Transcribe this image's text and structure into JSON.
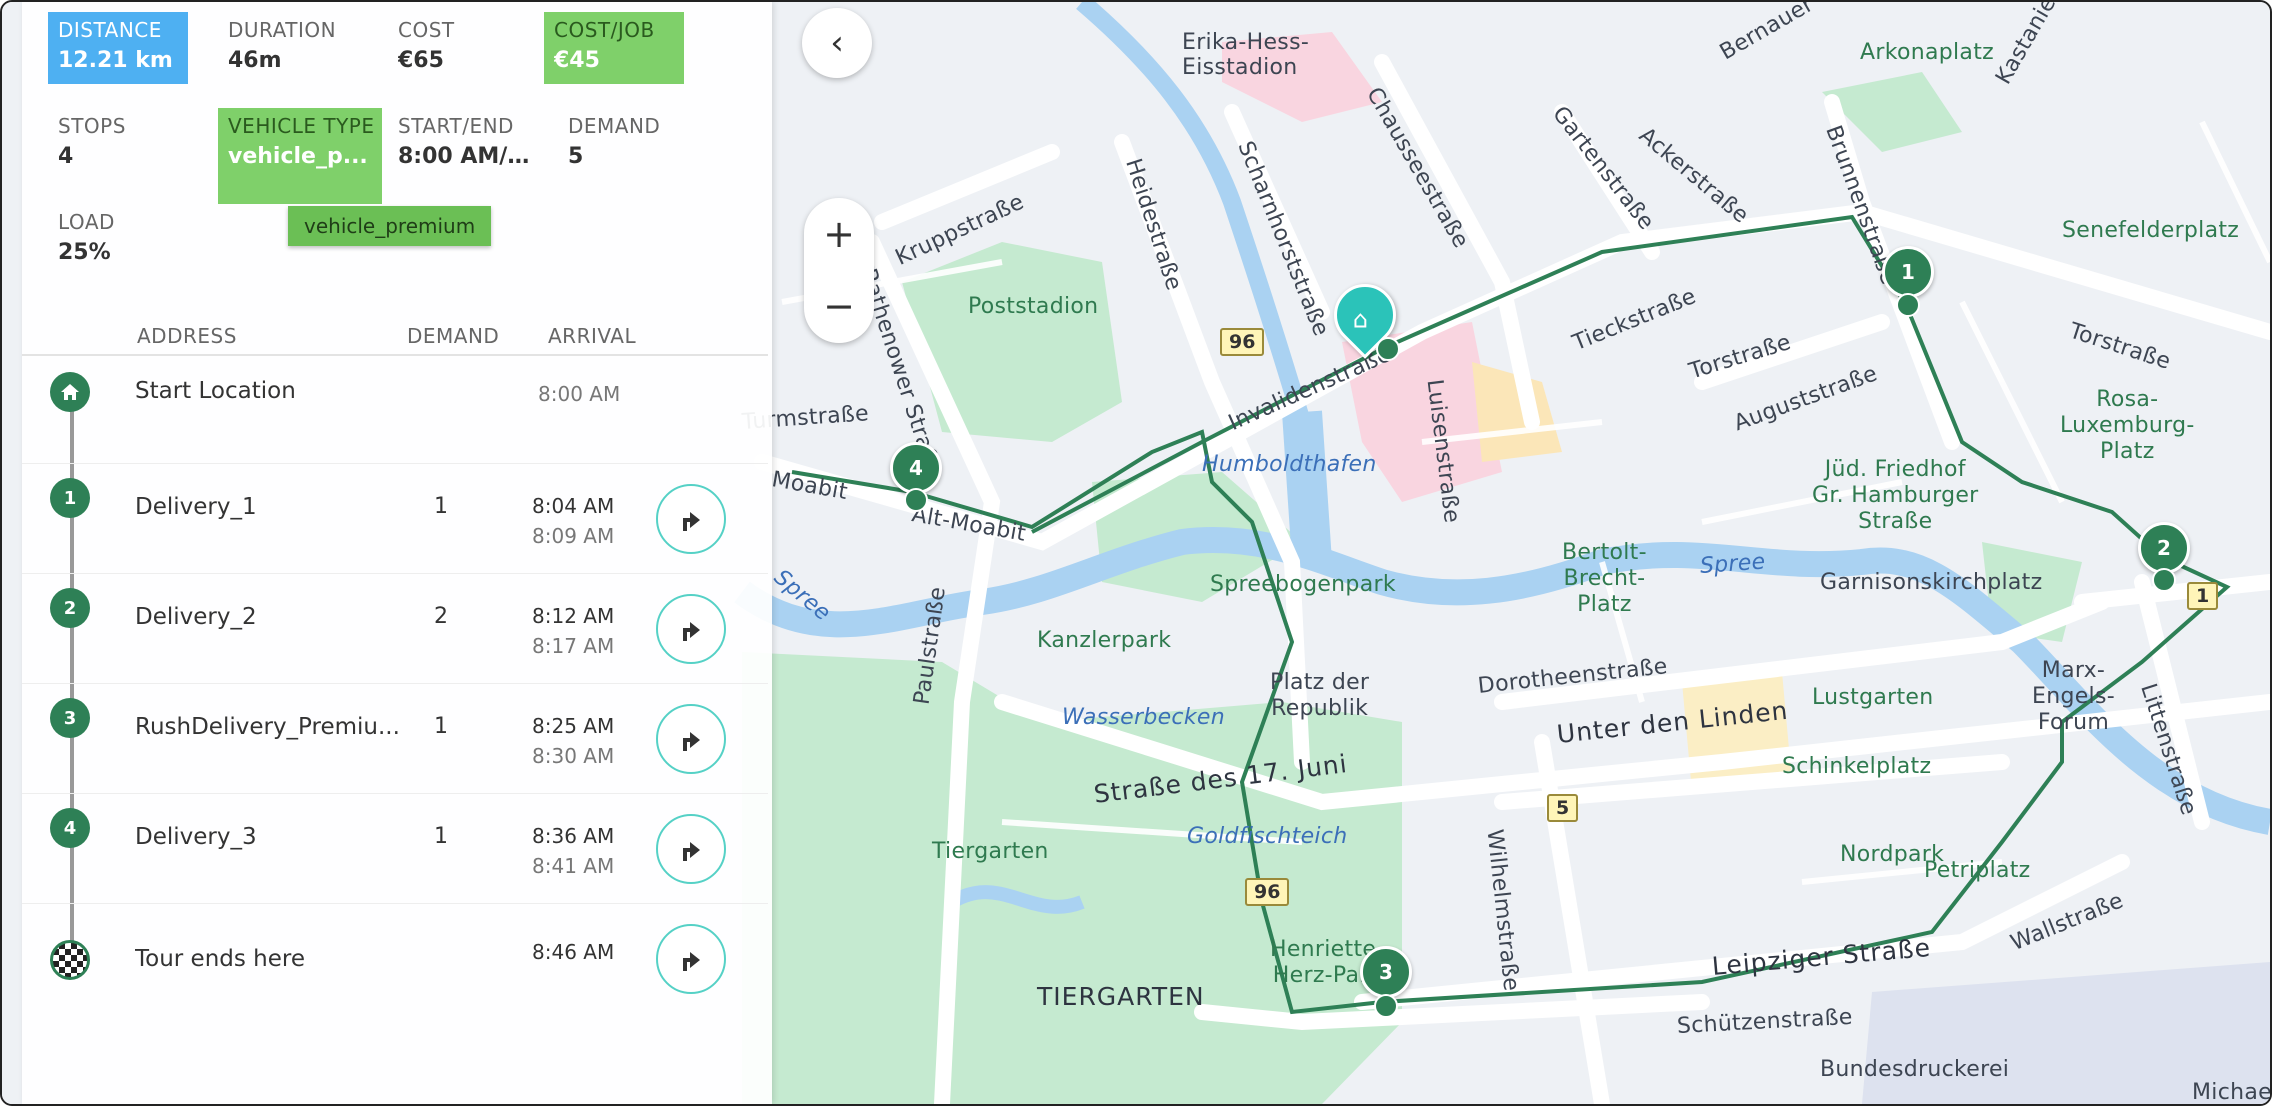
{
  "stats": {
    "distance": {
      "label": "DISTANCE",
      "value": "12.21 km"
    },
    "duration": {
      "label": "DURATION",
      "value": "46m"
    },
    "cost": {
      "label": "COST",
      "value": "€65"
    },
    "cost_job": {
      "label": "COST/JOB",
      "value": "€45"
    },
    "stops": {
      "label": "STOPS",
      "value": "4"
    },
    "vehicle_type": {
      "label": "VEHICLE TYPE",
      "value": "vehicle_p..."
    },
    "start_end": {
      "label": "START/END",
      "value": "8:00 AM/8:..."
    },
    "demand": {
      "label": "DEMAND",
      "value": "5"
    },
    "load": {
      "label": "LOAD",
      "value": "25%"
    }
  },
  "tooltip": "vehicle_premium",
  "table": {
    "headers": {
      "address": "ADDRESS",
      "demand": "DEMAND",
      "arrival": "ARRIVAL"
    },
    "rows": [
      {
        "step": "",
        "icon": "home-icon",
        "address": "Start Location",
        "demand": "",
        "arrival": "8:00 AM",
        "departure": ""
      },
      {
        "step": "1",
        "address": "Delivery_1",
        "demand": "1",
        "arrival": "8:04 AM",
        "departure": "8:09 AM"
      },
      {
        "step": "2",
        "address": "Delivery_2",
        "demand": "2",
        "arrival": "8:12 AM",
        "departure": "8:17 AM"
      },
      {
        "step": "3",
        "address": "RushDelivery_Premiu...",
        "demand": "1",
        "arrival": "8:25 AM",
        "departure": "8:30 AM"
      },
      {
        "step": "4",
        "address": "Delivery_3",
        "demand": "1",
        "arrival": "8:36 AM",
        "departure": "8:41 AM"
      },
      {
        "step": "",
        "icon": "finish-flag-icon",
        "address": "Tour ends here",
        "demand": "",
        "arrival": "8:46 AM",
        "departure": ""
      }
    ]
  },
  "map": {
    "labels": {
      "erika": "Erika-Hess-\nEisstadion",
      "arkonaplatz": "Arkonaplatz",
      "senefelderplatz": "Senefelderplatz",
      "poststadion": "Poststadion",
      "kruppstrasse": "Kruppstraße",
      "rathenower": "Rathenower Straße",
      "heidestrasse": "Heidestraße",
      "scharnhorst": "Scharnhorststraße",
      "chaussee": "Chausseestraße",
      "gartenstrasse": "Gartenstraße",
      "ackerstrasse": "Ackerstraße",
      "brunnenstrasse": "Brunnenstraße",
      "kastanien": "Kastanie",
      "bernauer": "Bernauer",
      "tieckstrasse": "Tieckstraße",
      "torstrasse1": "Torstraße",
      "torstrasse2": "Torstraße",
      "auguststrasse": "Auguststraße",
      "invaliden": "Invalidenstraße",
      "luisen": "Luisenstraße",
      "humboldthafen": "Humboldthafen",
      "turmstrasse": "Turmstraße",
      "moabit": "Moabit",
      "alt_moabit": "Alt-Moabit",
      "rosa": "Rosa-\nLuxemburg-\nPlatz",
      "juedfriedhof": "Jüd. Friedhof\nGr. Hamburger\nStraße",
      "bertolt": "Bertolt-\nBrecht-\nPlatz",
      "spree1": "Spree",
      "spree2": "Spree",
      "garnison": "Garnisonskirchplatz",
      "spreebogen": "Spreebogenpark",
      "kanzlerpark": "Kanzlerpark",
      "paulstrasse": "Paulstraße",
      "platzrepublik": "Platz der\nRepublik",
      "dorotheen": "Dorotheenstraße",
      "marx": "Marx-\nEngels-\nForum",
      "lustgarten": "Lustgarten",
      "wasserbecken": "Wasserbecken",
      "unterlinden": "Unter den Linden",
      "schinkelplatz": "Schinkelplatz",
      "strasse17": "Straße des 17. Juni",
      "littenstrasse": "Littenstraße",
      "tiergarten_park": "Tiergarten",
      "goldfisch": "Goldfischteich",
      "wilhelmstrasse": "Wilhelmstraße",
      "nordpark": "Nordpark",
      "petriplatz": "Petriplatz",
      "wallstrasse": "Wallstraße",
      "henriette": "Henriette-\nHerz-Park",
      "leipziger": "Leipziger Straße",
      "tiergarten_district": "TIERGARTEN",
      "schuetzen": "Schützenstraße",
      "bundesdruckerei": "Bundesdruckerei",
      "michael": "Michae",
      "moabit_district": "MOABIT"
    },
    "road_badges": [
      "96",
      "96",
      "5",
      "1"
    ],
    "markers": [
      "1",
      "2",
      "3",
      "4"
    ],
    "colors": {
      "route": "#2e8056",
      "start": "#2bc3b9",
      "park": "#c5ead0",
      "water": "#aad2f2",
      "hospital": "#f9d5e0",
      "road": "#ffffff"
    }
  },
  "controls": {
    "back": "‹",
    "zoom_in": "+",
    "zoom_out": "−"
  }
}
